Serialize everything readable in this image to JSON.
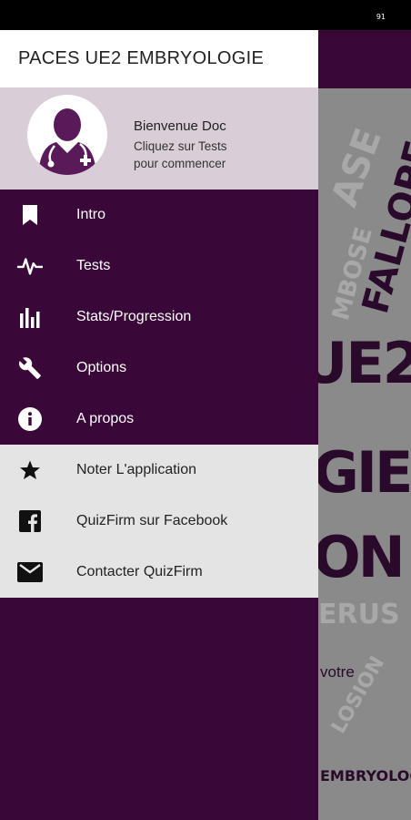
{
  "status": {
    "indicator": "91"
  },
  "drawer": {
    "title": "PACES UE2 EMBRYOLOGIE",
    "header": {
      "welcome": "Bienvenue Doc",
      "hint_line1": "Cliquez sur Tests",
      "hint_line2": "pour commencer"
    },
    "primary_items": [
      {
        "label": "Intro",
        "icon": "bookmark-icon"
      },
      {
        "label": "Tests",
        "icon": "pulse-icon"
      },
      {
        "label": "Stats/Progression",
        "icon": "bar-chart-icon"
      },
      {
        "label": "Options",
        "icon": "wrench-icon"
      },
      {
        "label": "A propos",
        "icon": "info-icon"
      }
    ],
    "secondary_items": [
      {
        "label": "Noter L'application",
        "icon": "star-icon"
      },
      {
        "label": "QuizFirm sur Facebook",
        "icon": "facebook-icon"
      },
      {
        "label": "Contacter QuizFirm",
        "icon": "mail-icon"
      }
    ]
  },
  "background": {
    "poster_words": [
      "FALLOPE",
      "UE2",
      "GIE",
      "ON"
    ],
    "partial_text": "votre"
  },
  "colors": {
    "drawer_bg": "#3a0838",
    "header_bg": "#d9cdd8",
    "secondary_bg": "#e4e4e4",
    "avatar_fill": "#5a1a5a"
  }
}
